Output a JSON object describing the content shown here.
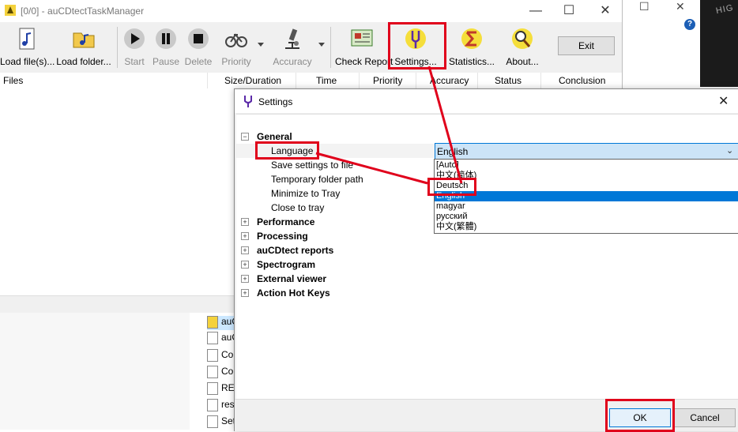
{
  "main_window": {
    "title": "[0/0] - auCDtectTaskManager",
    "controls": {
      "minimize": "—",
      "maximize": "☐",
      "close": "✕"
    }
  },
  "toolbar": {
    "load_files": "Load file(s)...",
    "load_folder": "Load folder...",
    "start": "Start",
    "pause": "Pause",
    "delete": "Delete",
    "priority": "Priority",
    "accuracy": "Accuracy",
    "check_report": "Check Report",
    "settings": "Settings...",
    "statistics": "Statistics...",
    "about": "About...",
    "exit": "Exit"
  },
  "columns": {
    "files": "Files",
    "size_duration": "Size/Duration",
    "time": "Time",
    "priority": "Priority",
    "accuracy": "Accuracy",
    "status": "Status",
    "conclusion": "Conclusion"
  },
  "explorer": {
    "items": [
      "auC",
      "auC",
      "Co",
      "Co",
      "REA",
      "res",
      "Set"
    ]
  },
  "settings_dialog": {
    "title": "Settings",
    "close": "✕",
    "tree": {
      "general": "General",
      "language": "Language",
      "save_settings": "Save settings to file",
      "temp_folder": "Temporary folder path",
      "minimize_tray": "Minimize to Tray",
      "close_tray": "Close to tray",
      "performance": "Performance",
      "processing": "Processing",
      "reports": "auCDtect reports",
      "spectrogram": "Spectrogram",
      "external_viewer": "External viewer",
      "hotkeys": "Action Hot Keys"
    },
    "language_combo": {
      "value": "English",
      "options": [
        "[Auto]",
        "中文(简体)",
        "Deutsch",
        "English",
        "magyar",
        "русский",
        "中文(繁體)"
      ],
      "highlighted": "English"
    },
    "ok": "OK",
    "cancel": "Cancel"
  },
  "bg": {
    "help_icon": "?",
    "strip_text": "HIG"
  },
  "colors": {
    "annotation_red": "#e0001b",
    "selection_blue": "#0078d7"
  }
}
